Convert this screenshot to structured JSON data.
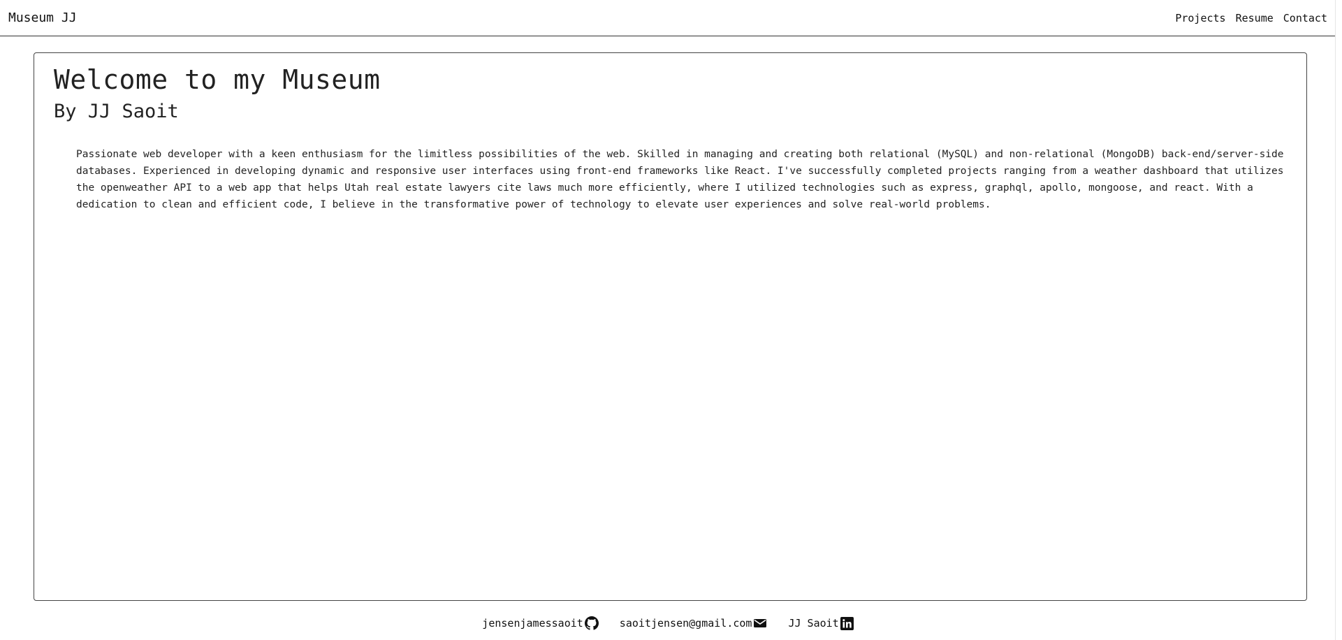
{
  "navbar": {
    "brand": "Museum JJ",
    "links": [
      "Projects",
      "Resume",
      "Contact"
    ]
  },
  "hero": {
    "title": "Welcome to my Museum",
    "subtitle": "By JJ Saoit",
    "bio": "Passionate web developer with a keen enthusiasm for the limitless possibilities of the web. Skilled in managing and creating both relational (MySQL) and non-relational (MongoDB) back-end/server-side databases. Experienced in developing dynamic and responsive user interfaces using front-end frameworks like React. I've successfully completed projects ranging from a weather dashboard that utilizes the openweather API to a web app that helps Utah real estate lawyers cite laws much more efficiently, where I utilized technologies such as express, graphql, apollo, mongoose, and react. With a dedication to clean and efficient code, I believe in the transformative power of technology to elevate user experiences and solve real-world problems."
  },
  "footer": {
    "links": [
      {
        "label": "jensenjamessaoit",
        "icon": "github-icon"
      },
      {
        "label": "saoitjensen@gmail.com",
        "icon": "envelope-icon"
      },
      {
        "label": "JJ Saoit",
        "icon": "linkedin-icon"
      }
    ]
  }
}
